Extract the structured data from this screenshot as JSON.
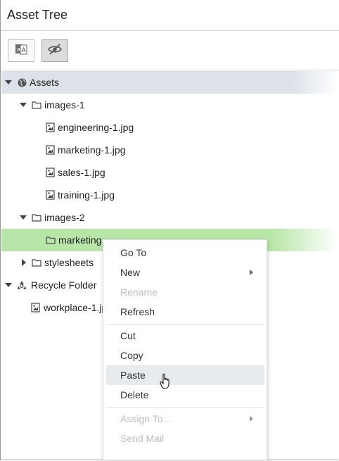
{
  "panel": {
    "title": "Asset Tree"
  },
  "toolbar": {
    "buttons": [
      {
        "icon": "translate-icon",
        "active": false
      },
      {
        "icon": "eye-slash-icon",
        "active": true
      }
    ]
  },
  "tree": {
    "assets_label": "Assets",
    "images1_label": "images-1",
    "files1": [
      "engineering-1.jpg",
      "marketing-1.jpg",
      "sales-1.jpg",
      "training-1.jpg"
    ],
    "images2_label": "images-2",
    "marketing_label": "marketing",
    "stylesheets_label": "stylesheets",
    "recycle_label": "Recycle Folder",
    "workplace_label": "workplace-1.jpg"
  },
  "context_menu": {
    "items": [
      {
        "label": "Go To",
        "enabled": true
      },
      {
        "label": "New",
        "enabled": true,
        "submenu": true
      },
      {
        "label": "Rename",
        "enabled": false
      },
      {
        "label": "Refresh",
        "enabled": true
      },
      {
        "label": "Cut",
        "enabled": true
      },
      {
        "label": "Copy",
        "enabled": true
      },
      {
        "label": "Paste",
        "enabled": true,
        "hovered": true
      },
      {
        "label": "Delete",
        "enabled": true
      },
      {
        "label": "Assign To...",
        "enabled": false,
        "submenu": true
      },
      {
        "label": "Send Mail",
        "enabled": false
      }
    ]
  },
  "colors": {
    "root_row_bg": "#dde2e8",
    "selected_row_bg": "#b8e6a8",
    "menu_hover_bg": "#e8ebee",
    "disabled_text": "#bdbdbd"
  }
}
